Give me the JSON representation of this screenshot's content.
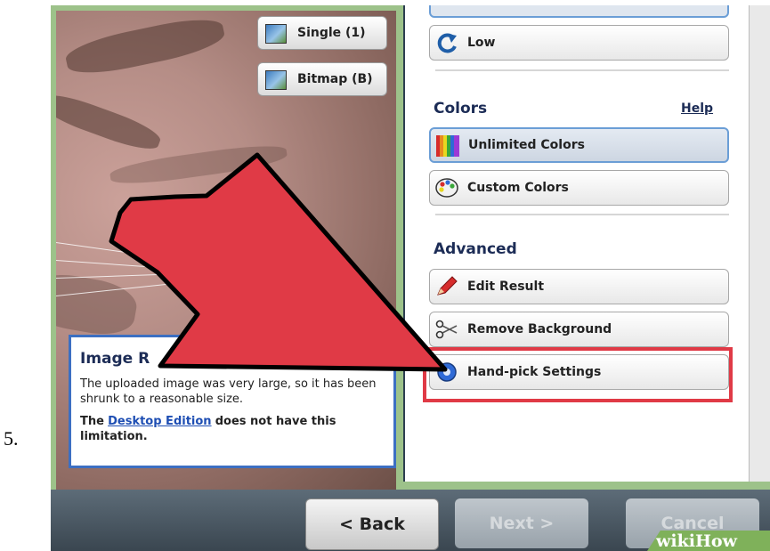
{
  "step": {
    "number": "5."
  },
  "left_buttons": [
    {
      "label": "Single (1)"
    },
    {
      "label": "Bitmap (B)"
    }
  ],
  "quality": {
    "low_label": "Low"
  },
  "colors": {
    "title": "Colors",
    "help": "Help",
    "unlimited": "Unlimited Colors",
    "custom": "Custom Colors"
  },
  "advanced": {
    "title": "Advanced",
    "edit_result": "Edit Result",
    "remove_background": "Remove Background",
    "hand_pick": "Hand-pick Settings"
  },
  "info": {
    "title": "Image R",
    "text1": "The uploaded image was very large, so it has been shrunk to a reasonable size.",
    "text2_prefix": "The",
    "text2_link": "Desktop Edition",
    "text2_suffix": "does not have this limitation."
  },
  "nav": {
    "back": "< Back",
    "next": "Next >",
    "cancel": "Cancel"
  },
  "watermark": {
    "wiki": "wiki",
    "how": "How"
  },
  "colors_theme": {
    "highlight": "#e03a46",
    "arrow": "#e03a46",
    "frame": "#9dc28a",
    "title_text": "#1c2c56"
  }
}
